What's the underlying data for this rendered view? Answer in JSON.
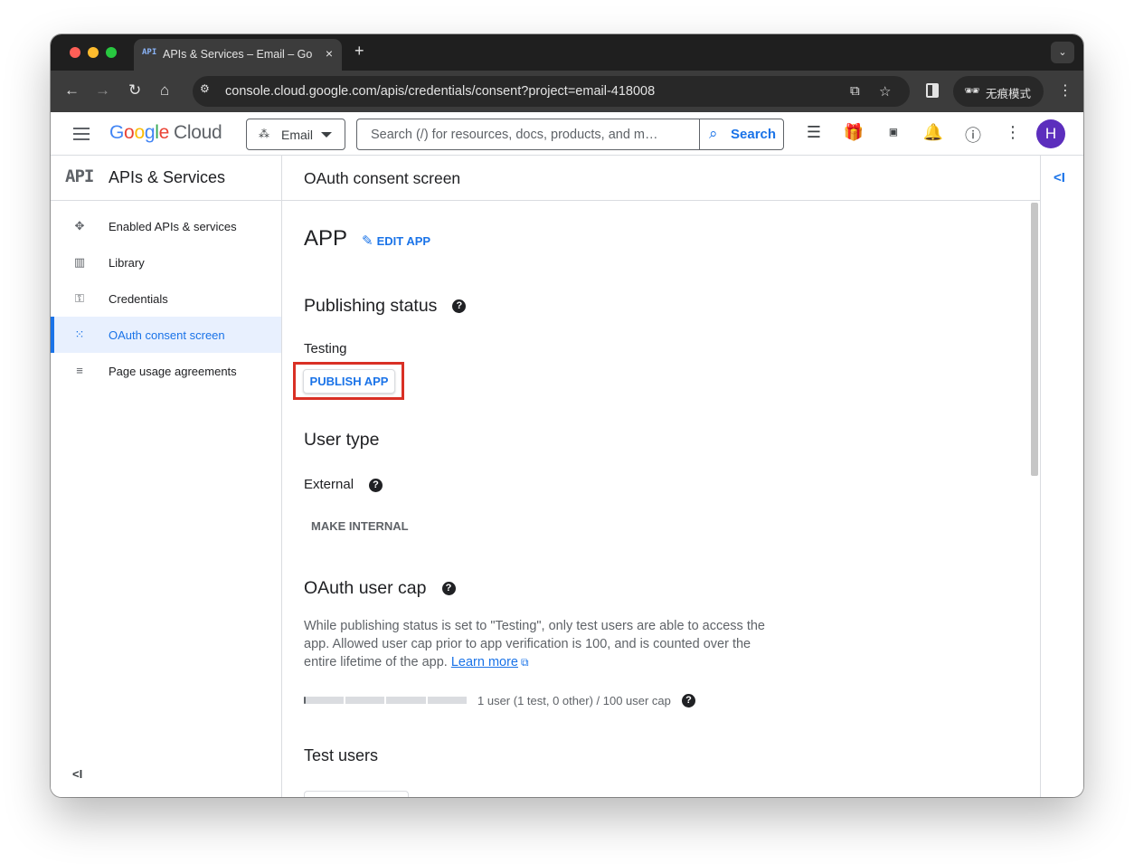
{
  "browser": {
    "tab_title": "APIs & Services – Email – Google Cloud",
    "tab_favicon": "API",
    "tab_close": "×",
    "new_tab": "+",
    "url": "console.cloud.google.com/apis/credentials/consent?project=email-418008",
    "incognito_label": "无痕模式",
    "icons": [
      "back-arrow-icon",
      "forward-arrow-icon",
      "reload-icon",
      "home-icon",
      "site-settings-icon",
      "translate-icon",
      "bookmark-star-icon",
      "side-panel-icon",
      "incognito-icon",
      "kebab-menu-icon"
    ]
  },
  "header": {
    "logo_letters": [
      "G",
      "o",
      "o",
      "g",
      "l",
      "e"
    ],
    "logo_product": "Cloud",
    "project_name": "Email",
    "search_placeholder": "Search (/) for resources, docs, products, and m…",
    "search_button": "Search",
    "avatar_initial": "H",
    "icons": [
      "menu-icon",
      "project-icon",
      "search-icon",
      "notes-icon",
      "gift-icon",
      "terminal-icon",
      "bell-icon",
      "help-icon",
      "kebab-menu-icon"
    ]
  },
  "sidebar": {
    "logo_text": "API",
    "title": "APIs & Services",
    "items": [
      {
        "label": "Enabled APIs & services",
        "icon": "enabled-apis-icon",
        "active": false
      },
      {
        "label": "Library",
        "icon": "library-icon",
        "active": false
      },
      {
        "label": "Credentials",
        "icon": "key-icon",
        "active": false
      },
      {
        "label": "OAuth consent screen",
        "icon": "consent-icon",
        "active": true
      },
      {
        "label": "Page usage agreements",
        "icon": "page-settings-icon",
        "active": false
      }
    ],
    "collapse_label": "<I"
  },
  "main": {
    "page_title": "OAuth consent screen",
    "app_name": "APP",
    "edit_app_label": "EDIT APP",
    "publishing_status_heading": "Publishing status",
    "publishing_status_value": "Testing",
    "publish_button": "PUBLISH APP",
    "user_type_heading": "User type",
    "user_type_value": "External",
    "make_internal_button": "MAKE INTERNAL",
    "user_cap_heading": "OAuth user cap",
    "user_cap_description": "While publishing status is set to \"Testing\", only test users are able to access the app. Allowed user cap prior to app verification is 100, and is counted over the entire lifetime of the app.",
    "learn_more_label": "Learn more",
    "user_cap_progress": 0.01,
    "user_cap_text": "1 user (1 test, 0 other) / 100 user cap",
    "test_users_heading": "Test users",
    "help_glyph": "?"
  },
  "right_rail": {
    "toggle_label": "<I"
  },
  "colors": {
    "accent": "#1a73e8",
    "highlight_border": "#d93025",
    "active_nav_bg": "#e8f0fe",
    "avatar_bg": "#5c2ebd",
    "chrome_dark": "#1f1f1f"
  }
}
